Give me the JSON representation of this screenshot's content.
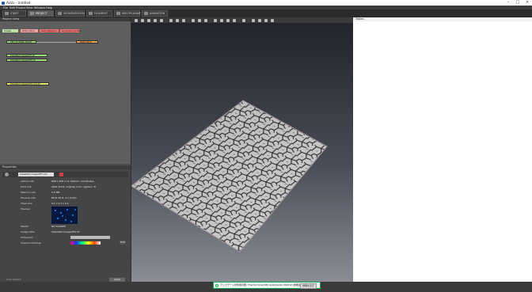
{
  "titlebar": {
    "title": "Avizo - Untitled"
  },
  "menu": [
    "File",
    "Edit",
    "Project",
    "View",
    "Window",
    "Help"
  ],
  "tabs": [
    {
      "label": "START",
      "active": false
    },
    {
      "label": "PROJECT",
      "active": true
    },
    {
      "label": "SEGMENTATION",
      "active": false
    },
    {
      "label": "FILAMENT",
      "active": false
    },
    {
      "label": "MULTIPLANAR",
      "active": false
    },
    {
      "label": "ANIMATION",
      "active": false
    }
  ],
  "project_view": {
    "header": "Project View",
    "open_data": "Open Data",
    "top_chips": [
      "Ortho Slice",
      "Auto Skeleton",
      "Generate Surface"
    ],
    "filter_chip": "Create",
    "nodes": [
      "C53_CF-PORC-300.tif",
      "Ortho Slice",
      "Classified image(IFF).tif",
      "Classified image(ISTI).tif",
      "Classified image(ISTI)-2nd.tif"
    ]
  },
  "properties": {
    "header": "Properties",
    "object_name": "Classified image(IFF).am",
    "rows": [
      {
        "key": "Lattice info",
        "value": "608 x 256 x 11 uniform coordinates"
      },
      {
        "key": "Data info",
        "value": "label (8-bit, original, num. regions: 3)"
      },
      {
        "key": "Memory size",
        "value": "1.6 MB"
      },
      {
        "key": "Physical size",
        "value": "60.8, 25.6, 1.1 (inch)"
      },
      {
        "key": "Voxel size",
        "value": "0.1 x 0.1 x 0.1"
      },
      {
        "key": "Preview",
        "value": ""
      },
      {
        "key": "Master",
        "value": "NO SOURCE"
      },
      {
        "key": "Image Data",
        "value": "Classified image(IFF).tif"
      },
      {
        "key": "Histogram",
        "value": ""
      },
      {
        "key": "Shared Colormap",
        "value": ""
      }
    ],
    "colormap_btn": "Edit",
    "apply_btn": "Apply",
    "auto_refresh": "Auto-refresh"
  },
  "tables": {
    "header": "Tables"
  },
  "notification": {
    "text": "アップデートが利用可能: Thermo Scientific Avizo(Avizo 2022.2) 詳細はこちら",
    "button": "詳細を表示"
  },
  "colors": {
    "node_green": "#9de07a",
    "node_orange": "#f0a050",
    "node_yellow": "#e8e86a",
    "chip_pink": "#f07070",
    "accent": "#00b050"
  }
}
